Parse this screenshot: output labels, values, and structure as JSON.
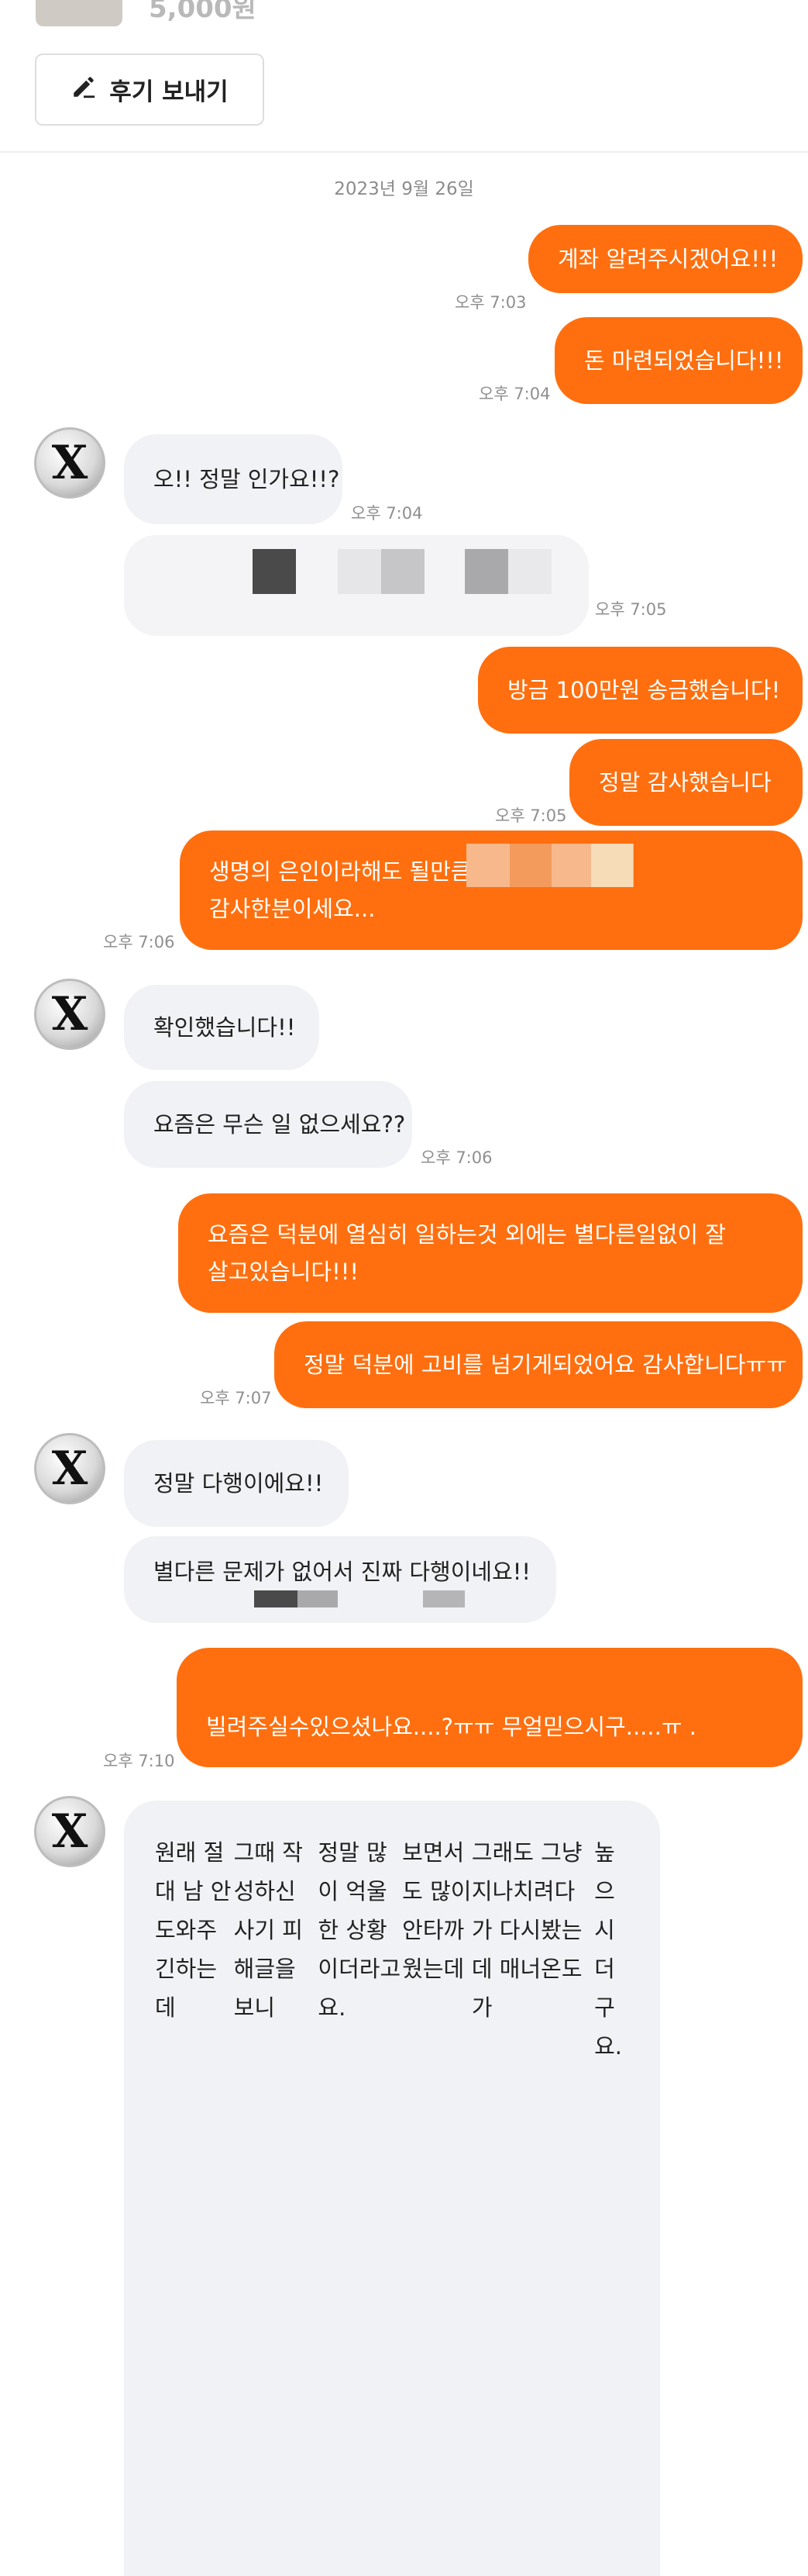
{
  "header": {
    "price": "5,000원",
    "review_button_label": "후기 보내기",
    "review_icon": "pencil-icon"
  },
  "chat": {
    "date": "2023년 9월 26일",
    "messages": [
      {
        "sender": "me",
        "text": "계좌 알려주시겠어요!!!",
        "time": "오후 7:03"
      },
      {
        "sender": "me",
        "text": "돈 마련되었습니다!!!",
        "time": "오후 7:04"
      },
      {
        "sender": "them",
        "text": "오!! 정말 인가요!!?",
        "time": "오후 7:04"
      },
      {
        "sender": "them",
        "text": "",
        "time": "오후 7:05"
      },
      {
        "sender": "me",
        "text": "방금 100만원 송금했습니다!",
        "time": ""
      },
      {
        "sender": "me",
        "text": "정말 감사했습니다",
        "time": "오후 7:05"
      },
      {
        "sender": "me",
        "line1": "생명의 은인이라해도 될만큼",
        "line2": "감사한분이세요...",
        "time": "오후 7:06"
      },
      {
        "sender": "them",
        "text": "확인했습니다!!",
        "time": ""
      },
      {
        "sender": "them",
        "text": "요즘은 무슨 일 없으세요??",
        "time": "오후 7:06"
      },
      {
        "sender": "me",
        "line1": "요즘은 덕분에 열심히 일하는것 외에는 별다른일없이 잘",
        "line2": "살고있습니다!!!",
        "time": ""
      },
      {
        "sender": "me",
        "text": "정말 덕분에 고비를 넘기게되었어요 감사합니다ㅠㅠ",
        "time": "오후 7:07"
      },
      {
        "sender": "them",
        "text": "정말 다행이에요!!",
        "time": ""
      },
      {
        "sender": "them",
        "text": "별다른 문제가 없어서 진짜 다행이네요!!",
        "time": ""
      },
      {
        "sender": "me",
        "text": "빌려주실수있으셨나요....?ㅠㅠ 무얼믿으시구.....ㅠ .",
        "time": "오후 7:10"
      },
      {
        "sender": "them",
        "lines": [
          "원래 절대 남 안 도와주긴하는데",
          "",
          "그때 작성하신 사기 피해글을 보니",
          "정말 많이 억울한 상황이더라고요.",
          "보면서도 많이 안타까웠는데",
          "",
          "그래도 그냥 지나치려다가 다시봤는데 매너온도가",
          "높으시더구요."
        ]
      }
    ]
  },
  "colors": {
    "my_bubble": "#ff6f0f",
    "their_bubble": "#f1f2f5",
    "timestamp": "#8f8f8f"
  }
}
